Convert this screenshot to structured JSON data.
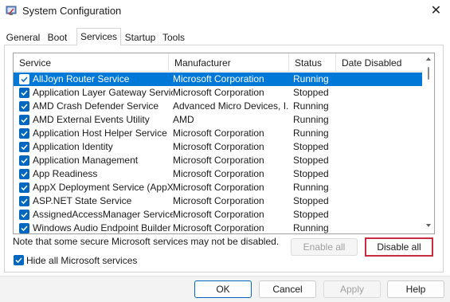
{
  "window": {
    "title": "System Configuration",
    "close_glyph": "✕"
  },
  "tabs": [
    {
      "label": "General"
    },
    {
      "label": "Boot"
    },
    {
      "label": "Services"
    },
    {
      "label": "Startup"
    },
    {
      "label": "Tools"
    }
  ],
  "active_tab": "Services",
  "columns": [
    "Service",
    "Manufacturer",
    "Status",
    "Date Disabled"
  ],
  "services": [
    {
      "name": "AllJoyn Router Service",
      "manufacturer": "Microsoft Corporation",
      "status": "Running",
      "date_disabled": "",
      "checked": true,
      "selected": true
    },
    {
      "name": "Application Layer Gateway Service",
      "manufacturer": "Microsoft Corporation",
      "status": "Stopped",
      "date_disabled": "",
      "checked": true,
      "selected": false
    },
    {
      "name": "AMD Crash Defender Service",
      "manufacturer": "Advanced Micro Devices, I...",
      "status": "Running",
      "date_disabled": "",
      "checked": true,
      "selected": false
    },
    {
      "name": "AMD External Events Utility",
      "manufacturer": "AMD",
      "status": "Running",
      "date_disabled": "",
      "checked": true,
      "selected": false
    },
    {
      "name": "Application Host Helper Service",
      "manufacturer": "Microsoft Corporation",
      "status": "Running",
      "date_disabled": "",
      "checked": true,
      "selected": false
    },
    {
      "name": "Application Identity",
      "manufacturer": "Microsoft Corporation",
      "status": "Stopped",
      "date_disabled": "",
      "checked": true,
      "selected": false
    },
    {
      "name": "Application Management",
      "manufacturer": "Microsoft Corporation",
      "status": "Stopped",
      "date_disabled": "",
      "checked": true,
      "selected": false
    },
    {
      "name": "App Readiness",
      "manufacturer": "Microsoft Corporation",
      "status": "Stopped",
      "date_disabled": "",
      "checked": true,
      "selected": false
    },
    {
      "name": "AppX Deployment Service (AppX...",
      "manufacturer": "Microsoft Corporation",
      "status": "Running",
      "date_disabled": "",
      "checked": true,
      "selected": false
    },
    {
      "name": "ASP.NET State Service",
      "manufacturer": "Microsoft Corporation",
      "status": "Stopped",
      "date_disabled": "",
      "checked": true,
      "selected": false
    },
    {
      "name": "AssignedAccessManager Service",
      "manufacturer": "Microsoft Corporation",
      "status": "Stopped",
      "date_disabled": "",
      "checked": true,
      "selected": false
    },
    {
      "name": "Windows Audio Endpoint Builder",
      "manufacturer": "Microsoft Corporation",
      "status": "Running",
      "date_disabled": "",
      "checked": true,
      "selected": false
    }
  ],
  "note": "Note that some secure Microsoft services may not be disabled.",
  "buttons": {
    "enable_all": "Enable all",
    "disable_all": "Disable all",
    "ok": "OK",
    "cancel": "Cancel",
    "apply": "Apply",
    "help": "Help"
  },
  "hide_microsoft": {
    "label": "Hide all Microsoft services",
    "checked": true
  },
  "colors": {
    "accent": "#0067c0",
    "selection": "#0078d7",
    "highlight_border": "#c72c3f"
  },
  "icons": {
    "app": "system-configuration-icon",
    "close": "close-icon",
    "checkbox": "checkmark-icon"
  }
}
